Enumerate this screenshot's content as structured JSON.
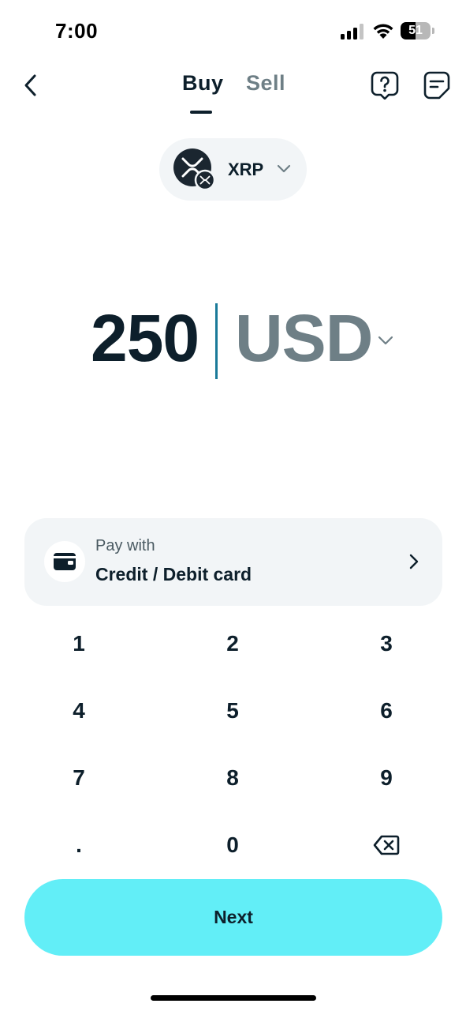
{
  "status_bar": {
    "time": "7:00",
    "battery_level": "51",
    "battery_fraction": 0.51
  },
  "header": {
    "back_icon": "chevron-left-icon",
    "tabs": [
      {
        "label": "Buy",
        "selected": true
      },
      {
        "label": "Sell",
        "selected": false
      }
    ],
    "help_icon": "help-bubble-icon",
    "orders_icon": "document-icon"
  },
  "asset_selector": {
    "symbol": "XRP",
    "logo_icon": "xrp-logo-icon",
    "chevron_icon": "chevron-down-icon"
  },
  "amount": {
    "value": "250",
    "currency": "USD",
    "chevron_icon": "chevron-down-icon"
  },
  "payment": {
    "label": "Pay with",
    "method": "Credit / Debit card",
    "icon": "wallet-icon",
    "chevron_icon": "chevron-right-icon"
  },
  "keypad": {
    "keys": [
      "1",
      "2",
      "3",
      "4",
      "5",
      "6",
      "7",
      "8",
      "9",
      ".",
      "0"
    ],
    "backspace_icon": "backspace-icon"
  },
  "next_button": {
    "label": "Next"
  },
  "colors": {
    "text_primary": "#0d1f2b",
    "text_muted": "#6e7f86",
    "accent": "#62eef7",
    "card_background": "#f2f5f7",
    "cursor": "#1a7a99"
  }
}
